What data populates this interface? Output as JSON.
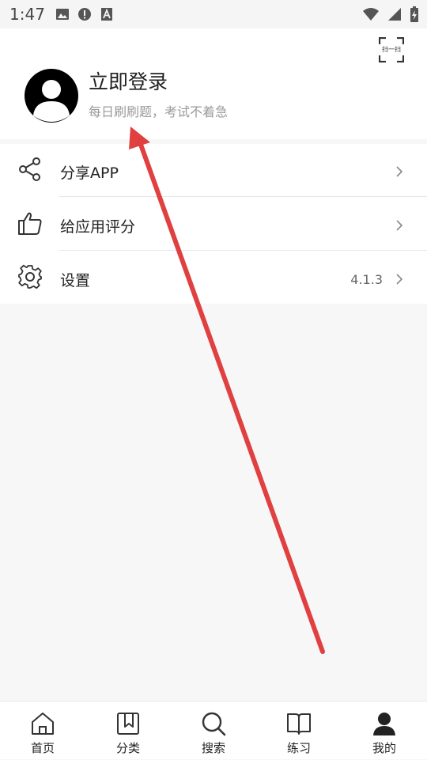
{
  "status_bar": {
    "time": "1:47",
    "left_icons": [
      "image-icon",
      "alert-icon",
      "text-icon"
    ],
    "right_icons": [
      "wifi-icon",
      "signal-icon",
      "battery-charging-icon"
    ]
  },
  "profile": {
    "title": "立即登录",
    "subtitle": "每日刷刷题，考试不着急",
    "scan_label": "扫一扫"
  },
  "menu": {
    "items": [
      {
        "label": "分享APP",
        "icon": "share-icon"
      },
      {
        "label": "给应用评分",
        "icon": "thumbs-up-icon"
      },
      {
        "label": "设置",
        "icon": "settings-gear-icon",
        "value": "4.1.3"
      }
    ]
  },
  "bottom_nav": {
    "items": [
      {
        "label": "首页",
        "icon": "home-icon"
      },
      {
        "label": "分类",
        "icon": "bookmark-category-icon"
      },
      {
        "label": "搜索",
        "icon": "search-icon"
      },
      {
        "label": "练习",
        "icon": "book-icon"
      },
      {
        "label": "我的",
        "icon": "user-icon"
      }
    ]
  },
  "colors": {
    "arrow": "#e04040",
    "background": "#f7f7f7",
    "accent_text": "#222222",
    "muted_text": "#9a9a9a"
  }
}
